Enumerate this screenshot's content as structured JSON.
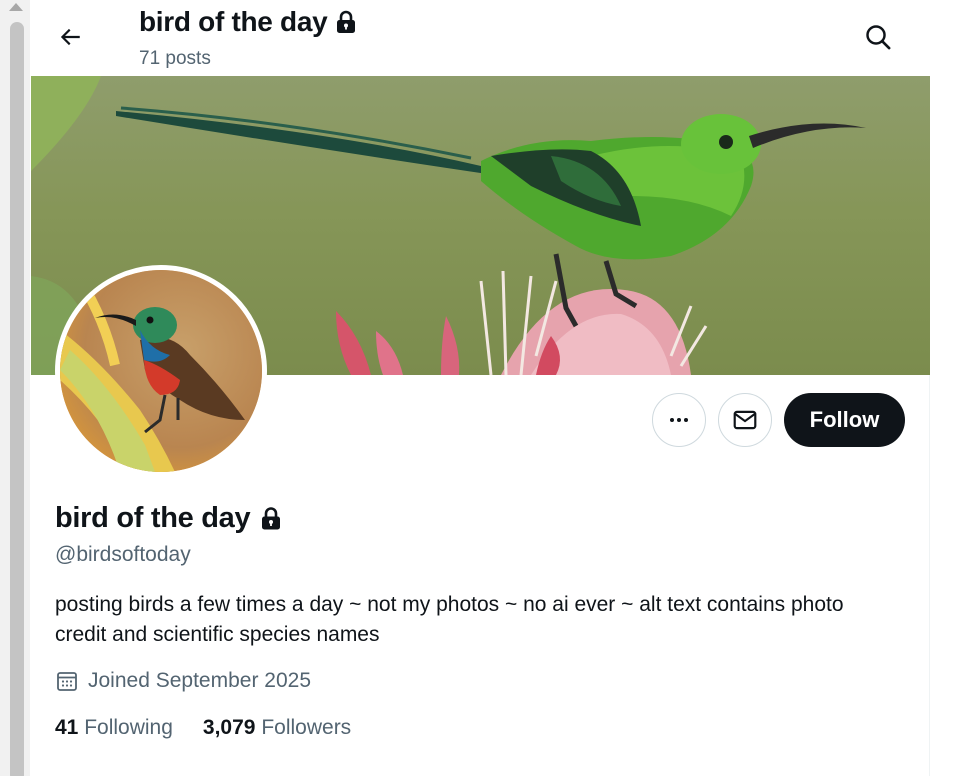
{
  "header": {
    "title": "bird of the day",
    "post_count": "71 posts"
  },
  "icons": {
    "back": "arrow-left-icon",
    "search": "search-icon",
    "lock": "lock-icon",
    "more": "more-icon",
    "message": "mail-icon",
    "calendar": "calendar-icon"
  },
  "profile": {
    "name": "bird of the day",
    "handle": "@birdsoftoday",
    "bio": "posting birds a few times a day ~ not my photos ~ no ai ever ~ alt text contains photo credit and scientific species names",
    "joined": "Joined September 2025",
    "following_count": "41",
    "following_label": "Following",
    "followers_count": "3,079",
    "followers_label": "Followers"
  },
  "actions": {
    "follow_label": "Follow"
  },
  "colors": {
    "text_primary": "#0f1419",
    "text_secondary": "#536471",
    "follow_bg": "#0f1419",
    "border": "#cfd9de"
  }
}
